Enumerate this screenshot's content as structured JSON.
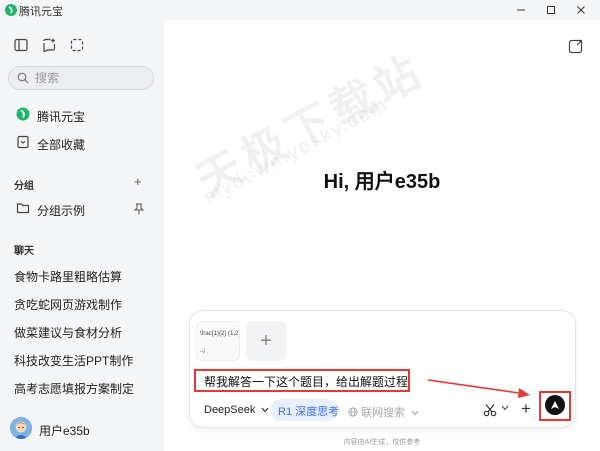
{
  "window": {
    "title": "腾讯元宝"
  },
  "sidebar": {
    "search_placeholder": "搜索",
    "nav": [
      {
        "label": "腾讯元宝",
        "icon": "yuanbao-logo-icon"
      },
      {
        "label": "全部收藏",
        "icon": "bookmark-icon"
      }
    ],
    "groups_title": "分组",
    "groups_add": "+",
    "group_items": [
      {
        "label": "分组示例",
        "icon": "folder-icon"
      }
    ],
    "chats_title": "聊天",
    "chats": [
      "食物卡路里粗略估算",
      "贪吃蛇网页游戏制作",
      "做菜建议与食材分析",
      "科技改变生活PPT制作",
      "高考志愿填报方案制定"
    ],
    "user_name": "用户e35b"
  },
  "main": {
    "greeting": "Hi, 用户e35b",
    "watermark": "天极下载站",
    "watermark_url": "mydown.yesky.com",
    "attachment": {
      "line1": "\\frac{1}{2} (1,2), 则",
      "line2": "-√"
    },
    "add_label": "+",
    "prompt": "帮我解答一下这个题目，给出解题过程",
    "model": "DeepSeek",
    "r1_label": "R1 深度思考",
    "web_label": "联网搜索",
    "plus_label": "+",
    "disclaimer": "内容由AI生成，仅供参考"
  },
  "colors": {
    "accent_red": "#e53935",
    "accent_blue": "#3b6ef5",
    "brand_green": "#1fb56b"
  }
}
